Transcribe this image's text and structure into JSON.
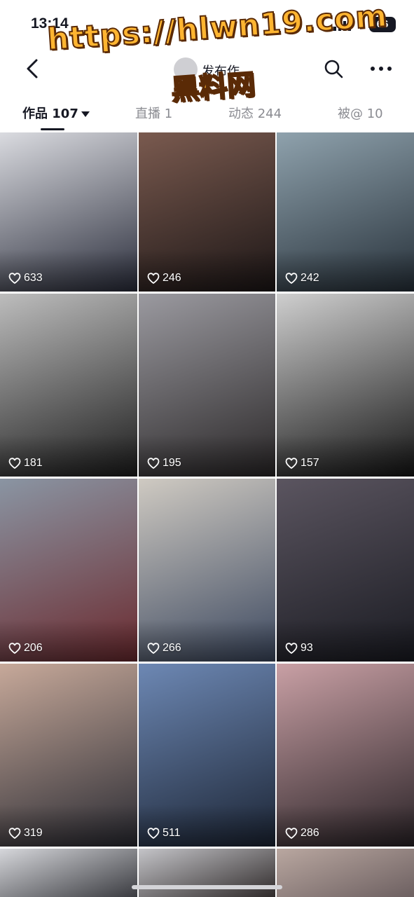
{
  "status_bar": {
    "time": "13:14",
    "battery": "66"
  },
  "header": {
    "user_name": "发布作"
  },
  "watermark": {
    "url": "https://hlwn19.com",
    "name": "黑料网"
  },
  "tabs": [
    {
      "label": "作品",
      "count": "107"
    },
    {
      "label": "直播",
      "count": "1"
    },
    {
      "label": "动态",
      "count": "244"
    },
    {
      "label": "被@",
      "count": "10"
    }
  ],
  "posts": [
    {
      "likes": "633",
      "tone": [
        "#dadbe0",
        "#2b2e3c"
      ]
    },
    {
      "likes": "246",
      "tone": [
        "#7a5a4f",
        "#1c1616"
      ]
    },
    {
      "likes": "242",
      "tone": [
        "#8fa2ad",
        "#27313a"
      ]
    },
    {
      "likes": "181",
      "tone": [
        "#bdbdbd",
        "#1d1d1d"
      ]
    },
    {
      "likes": "195",
      "tone": [
        "#9b9aa0",
        "#2a2728"
      ]
    },
    {
      "likes": "157",
      "tone": [
        "#cfcfcf",
        "#151515"
      ]
    },
    {
      "likes": "206",
      "tone": [
        "#8a95a3",
        "#6b2a2f"
      ]
    },
    {
      "likes": "266",
      "tone": [
        "#cfcac2",
        "#3d4960"
      ]
    },
    {
      "likes": "93",
      "tone": [
        "#5b5560",
        "#1a1b22"
      ]
    },
    {
      "likes": "319",
      "tone": [
        "#c7a99a",
        "#2a2b33"
      ]
    },
    {
      "likes": "511",
      "tone": [
        "#6d88b4",
        "#1c2535"
      ]
    },
    {
      "likes": "286",
      "tone": [
        "#c9a0a5",
        "#2a2327"
      ]
    },
    {
      "likes": "",
      "tone": [
        "#d6d7db",
        "#3a3b40"
      ]
    },
    {
      "likes": "",
      "tone": [
        "#c4c4c8",
        "#2f2a2a"
      ]
    },
    {
      "likes": "",
      "tone": [
        "#b9a7a0",
        "#6d6061"
      ]
    }
  ]
}
